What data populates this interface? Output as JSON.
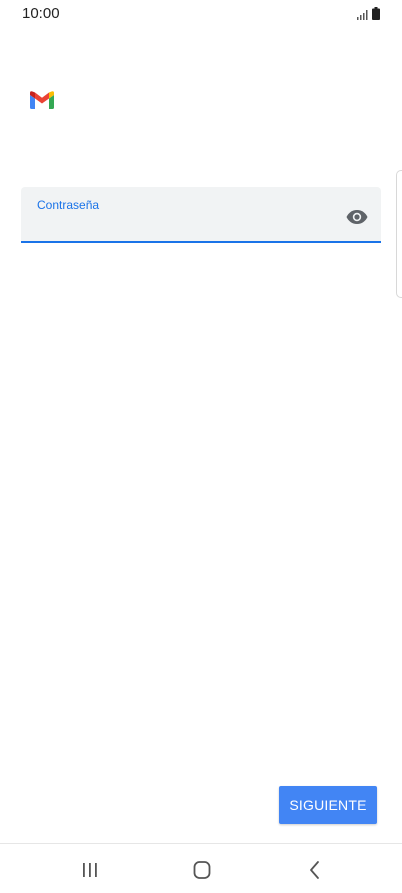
{
  "status_bar": {
    "time": "10:00",
    "icons": [
      "signal-icon",
      "battery-icon"
    ]
  },
  "app": {
    "logo": "gmail-logo-icon",
    "colors": {
      "accent": "#1a73e8",
      "button": "#4285f4",
      "field_bg": "#f1f3f4"
    }
  },
  "password_field": {
    "label": "Contraseña",
    "value": "",
    "toggle_icon": "eye-icon"
  },
  "actions": {
    "next_label": "SIGUIENTE"
  },
  "nav_bar": {
    "items": [
      "recents-icon",
      "home-icon",
      "back-icon"
    ]
  }
}
